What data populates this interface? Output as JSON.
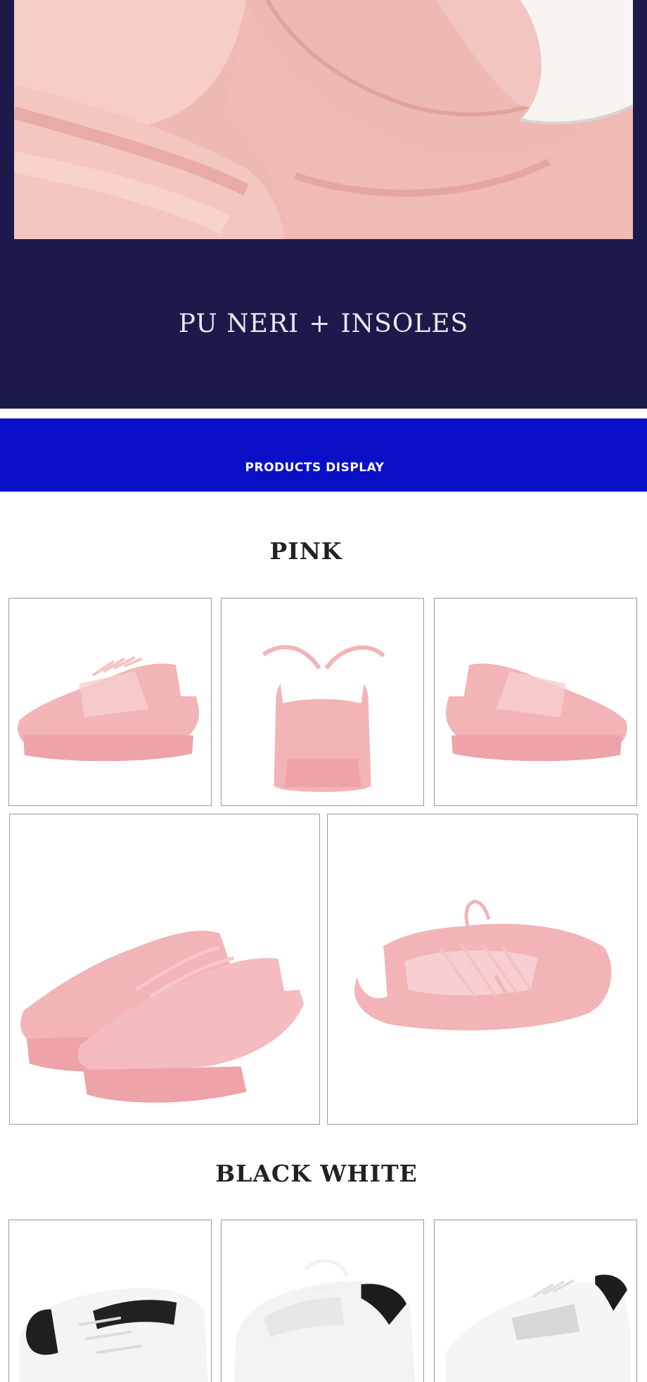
{
  "detail_banner": {
    "caption_left": "PU NERI",
    "caption_separator": "+",
    "caption_right": "INSOLES"
  },
  "products_banner": {
    "label": "PRODUCTS DISPLAY"
  },
  "sections": {
    "pink": {
      "title": "PINK"
    },
    "black_white": {
      "title": "BLACK WHITE"
    }
  },
  "colors": {
    "navy_banner": "#1b1a4b",
    "blue_banner": "#0a0fc8",
    "pink_shoe": "#f2b4b6",
    "frame_border": "#9a9a9a"
  }
}
